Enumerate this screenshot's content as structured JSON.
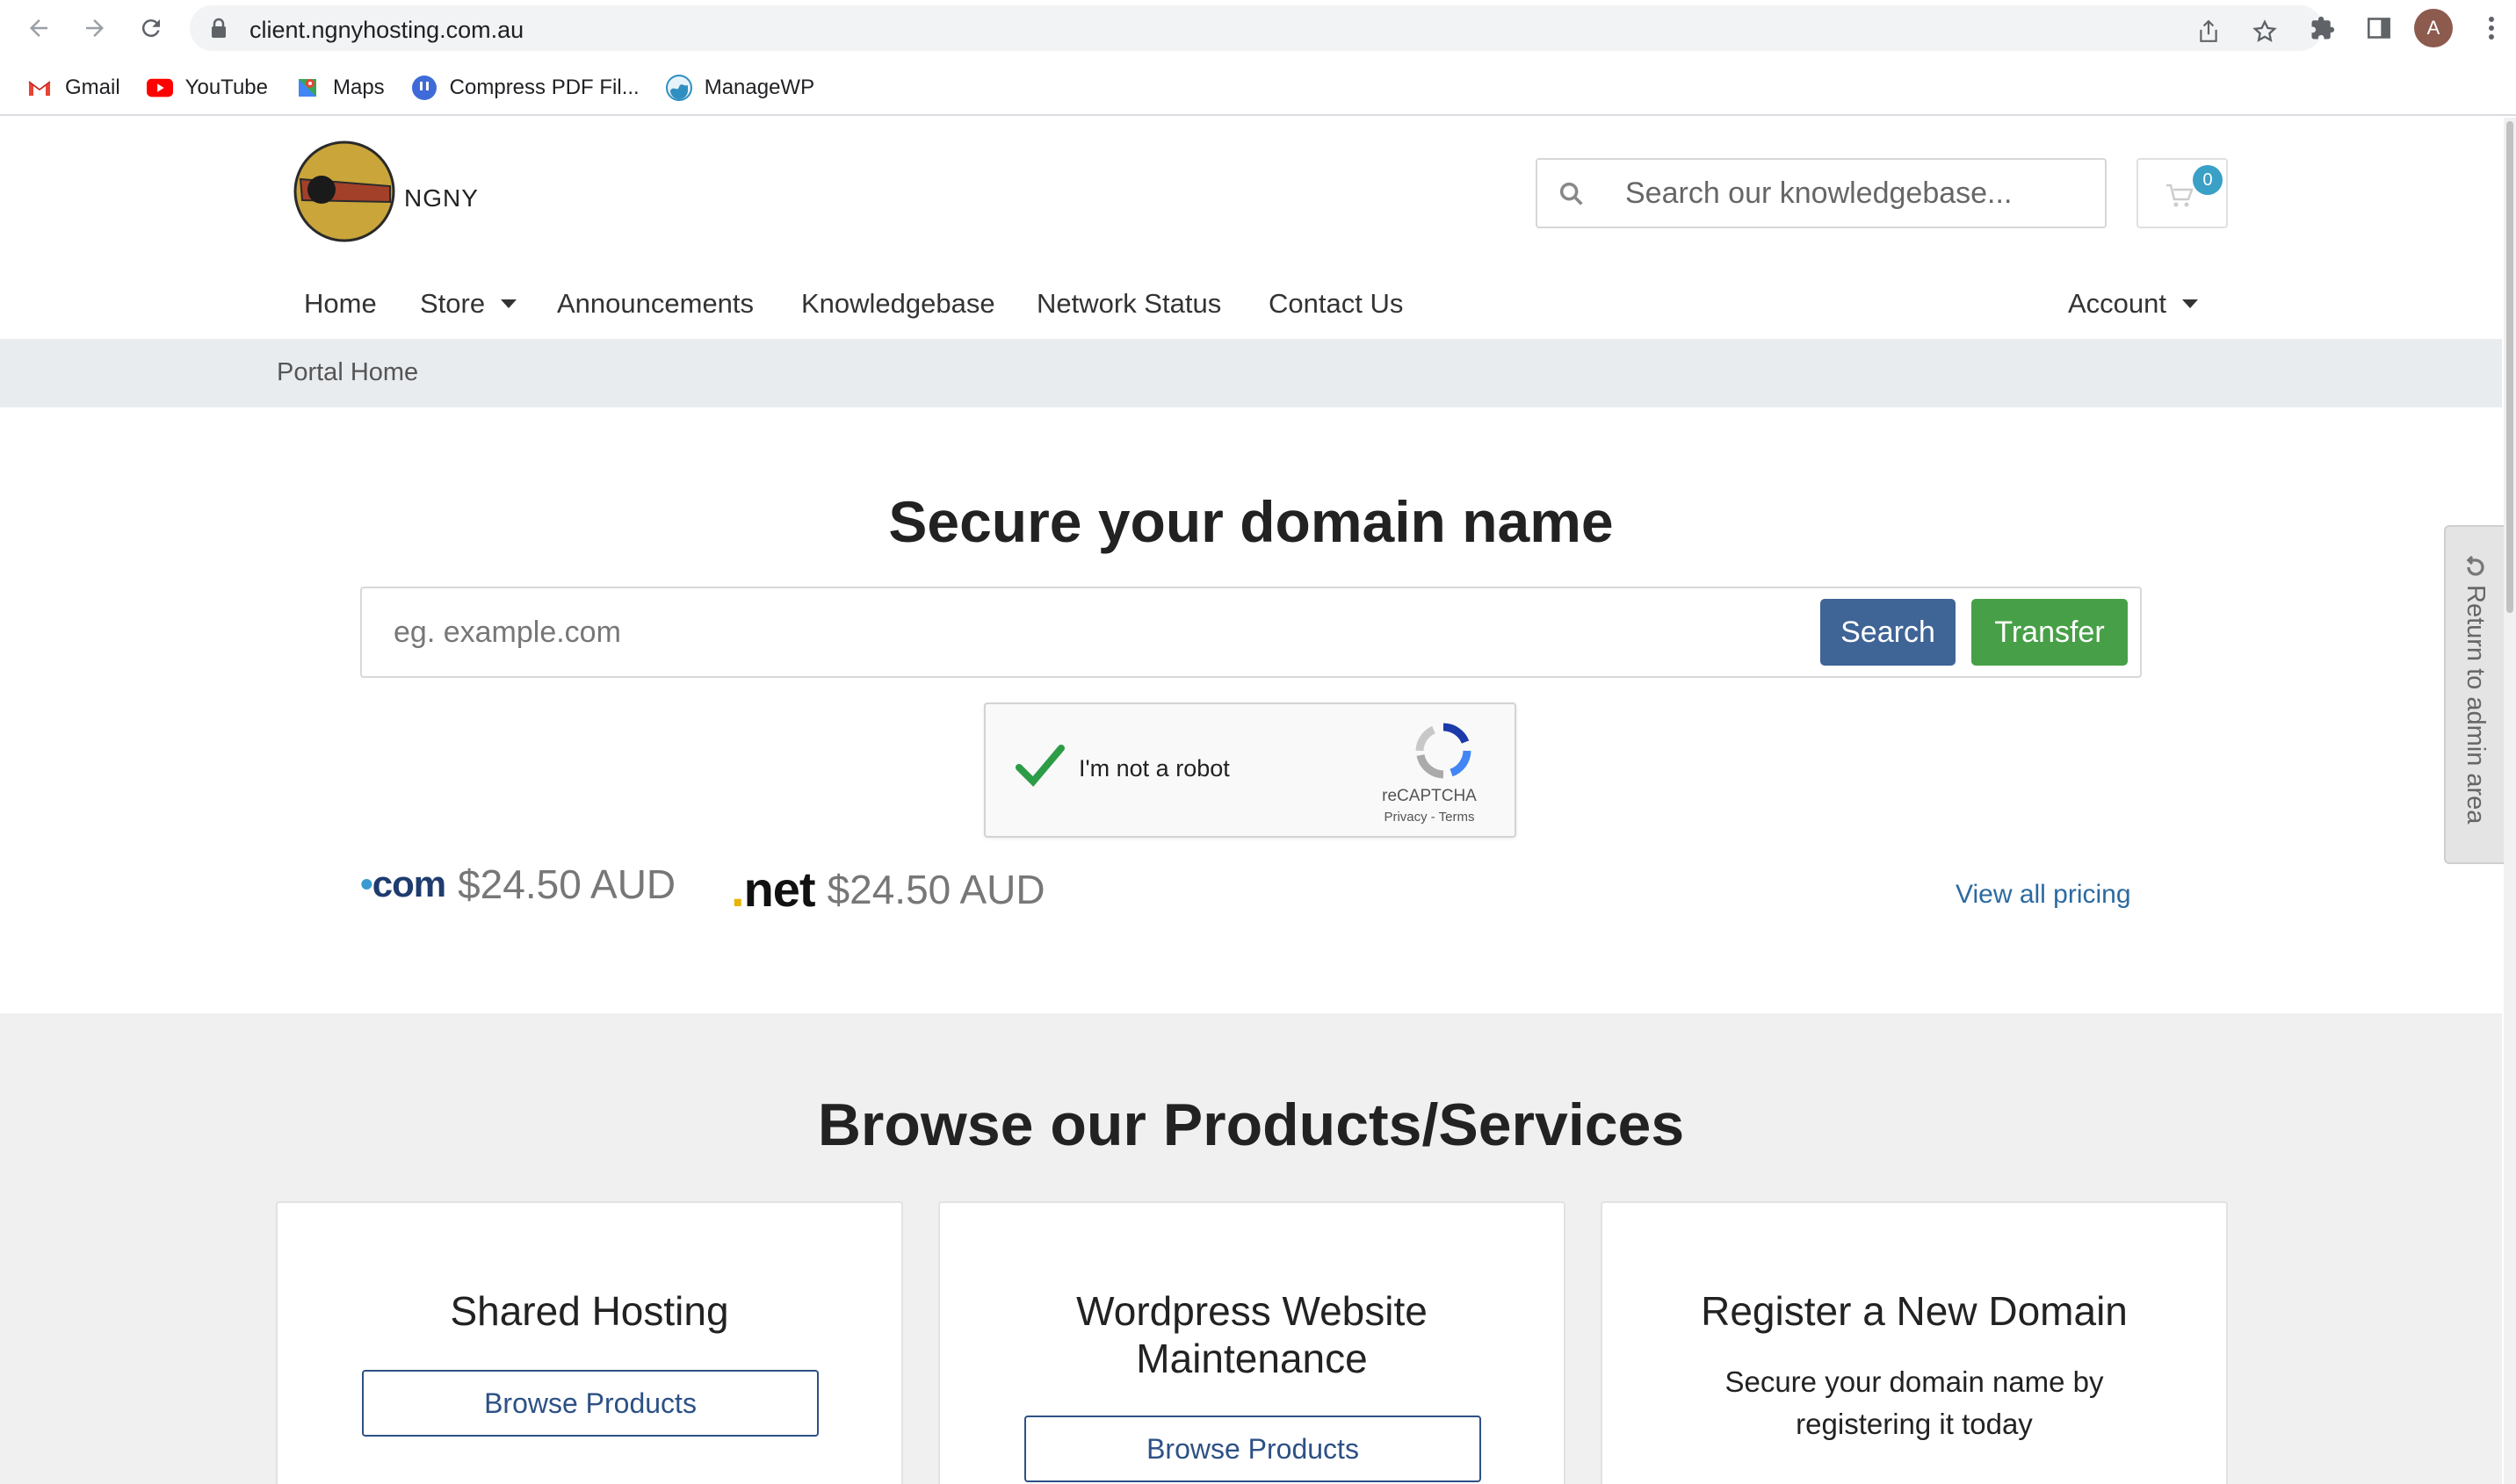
{
  "browser": {
    "url": "client.ngnyhosting.com.au",
    "avatar_letter": "A",
    "bookmarks": [
      {
        "label": "Gmail",
        "icon": "gmail-icon"
      },
      {
        "label": "YouTube",
        "icon": "youtube-icon"
      },
      {
        "label": "Maps",
        "icon": "maps-icon"
      },
      {
        "label": "Compress PDF Fil...",
        "icon": "compress-pdf-icon"
      },
      {
        "label": "ManageWP",
        "icon": "managewp-icon"
      }
    ]
  },
  "header": {
    "logo_text": "NGNY",
    "kb_search_placeholder": "Search our knowledgebase...",
    "cart_count": "0"
  },
  "nav": {
    "home": "Home",
    "store": "Store",
    "announcements": "Announcements",
    "knowledgebase": "Knowledgebase",
    "network_status": "Network Status",
    "contact_us": "Contact Us",
    "account": "Account"
  },
  "breadcrumb": "Portal Home",
  "domain": {
    "title": "Secure your domain name",
    "placeholder": "eg. example.com",
    "search_label": "Search",
    "transfer_label": "Transfer",
    "captcha_label": "I'm not a robot",
    "captcha_brand": "reCAPTCHA",
    "captcha_terms": "Privacy - Terms",
    "tlds": [
      {
        "tld": "com",
        "price": "$24.50 AUD"
      },
      {
        "tld": "net",
        "price": "$24.50 AUD"
      }
    ],
    "view_all_pricing": "View all pricing"
  },
  "products": {
    "title": "Browse our Products/Services",
    "cards": [
      {
        "title": "Shared Hosting",
        "button": "Browse Products"
      },
      {
        "title_line1": "Wordpress Website",
        "title_line2": "Maintenance",
        "button": "Browse Products"
      },
      {
        "title": "Register a New Domain",
        "desc_line1": "Secure your domain name by",
        "desc_line2": "registering it today"
      }
    ]
  },
  "admin_tab": "Return to admin area",
  "colors": {
    "search_button": "#3f6496",
    "transfer_button": "#47a047",
    "link": "#2b6aa0",
    "cart_badge": "#3aa0c6"
  }
}
